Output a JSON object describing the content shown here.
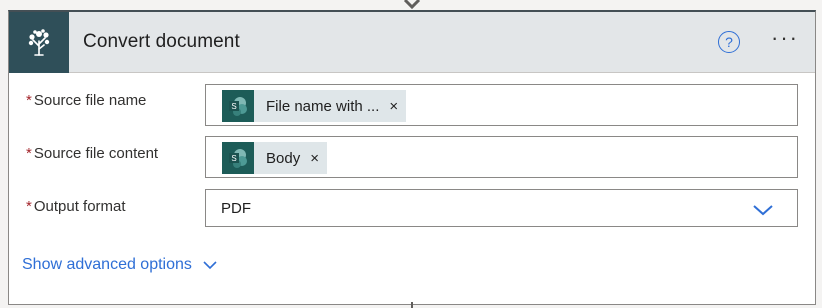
{
  "action": {
    "title": "Convert document",
    "help_symbol": "?",
    "more_symbol": "···"
  },
  "fields": {
    "source_file_name": {
      "label": "Source file name",
      "required_mark": "*",
      "token_text": "File name with ...",
      "token_icon": "sharepoint-icon",
      "remove_symbol": "×"
    },
    "source_file_content": {
      "label": "Source file content",
      "required_mark": "*",
      "token_text": "Body",
      "token_icon": "sharepoint-icon",
      "remove_symbol": "×"
    },
    "output_format": {
      "label": "Output format",
      "required_mark": "*",
      "value": "PDF"
    }
  },
  "advanced": {
    "label": "Show advanced options"
  },
  "colors": {
    "header_bg": "#e3e6e8",
    "icon_bg": "#2f4f59",
    "token_bg": "#dfe6e9",
    "sharepoint_icon_bg": "#1d5c58",
    "link": "#2f6fd6",
    "required": "#a4262c"
  }
}
